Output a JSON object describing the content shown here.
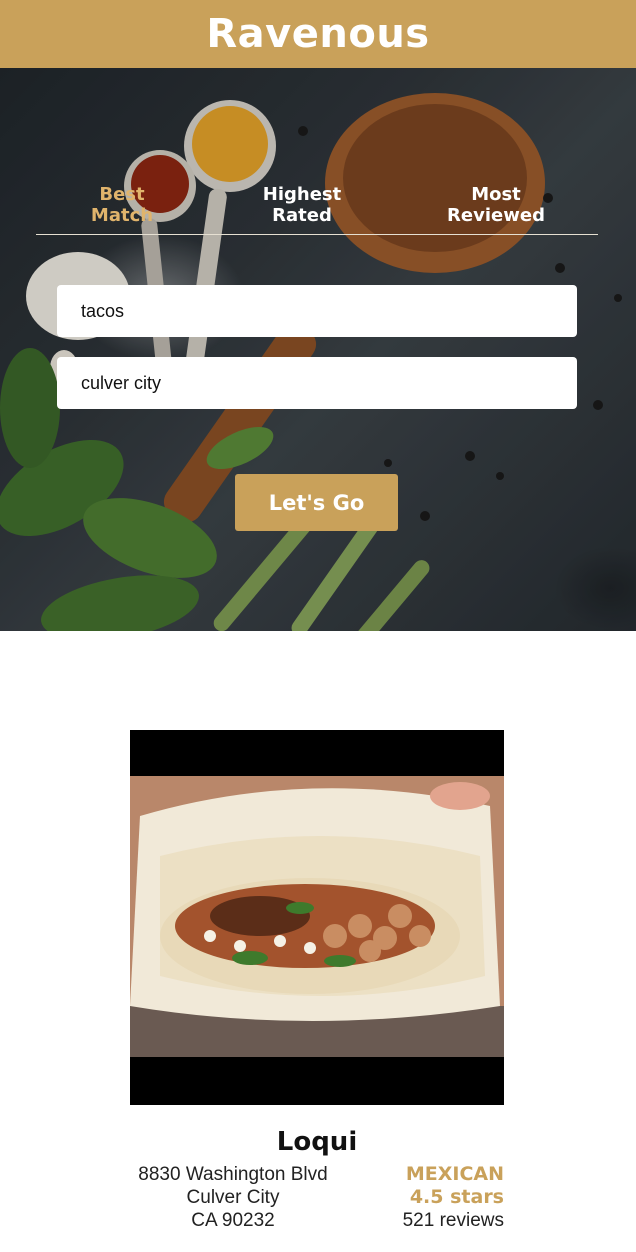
{
  "header": {
    "title": "Ravenous"
  },
  "search": {
    "tabs": [
      {
        "label": "Best Match",
        "line1": "Best",
        "line2": "Match",
        "active": true
      },
      {
        "label": "Highest Rated",
        "line1": "Highest",
        "line2": "Rated",
        "active": false
      },
      {
        "label": "Most Reviewed",
        "line1": "Most",
        "line2": "Reviewed",
        "active": false
      }
    ],
    "term_value": "tacos",
    "location_value": "culver city",
    "submit_label": "Let's Go"
  },
  "business": {
    "name": "Loqui",
    "address": "8830 Washington Blvd",
    "city": "Culver City",
    "state_zip": "CA 90232",
    "category": "MEXICAN",
    "rating": "4.5 stars",
    "review_count": "521 reviews"
  },
  "colors": {
    "accent": "#c9a15a",
    "active_tab": "#e0b46c"
  }
}
